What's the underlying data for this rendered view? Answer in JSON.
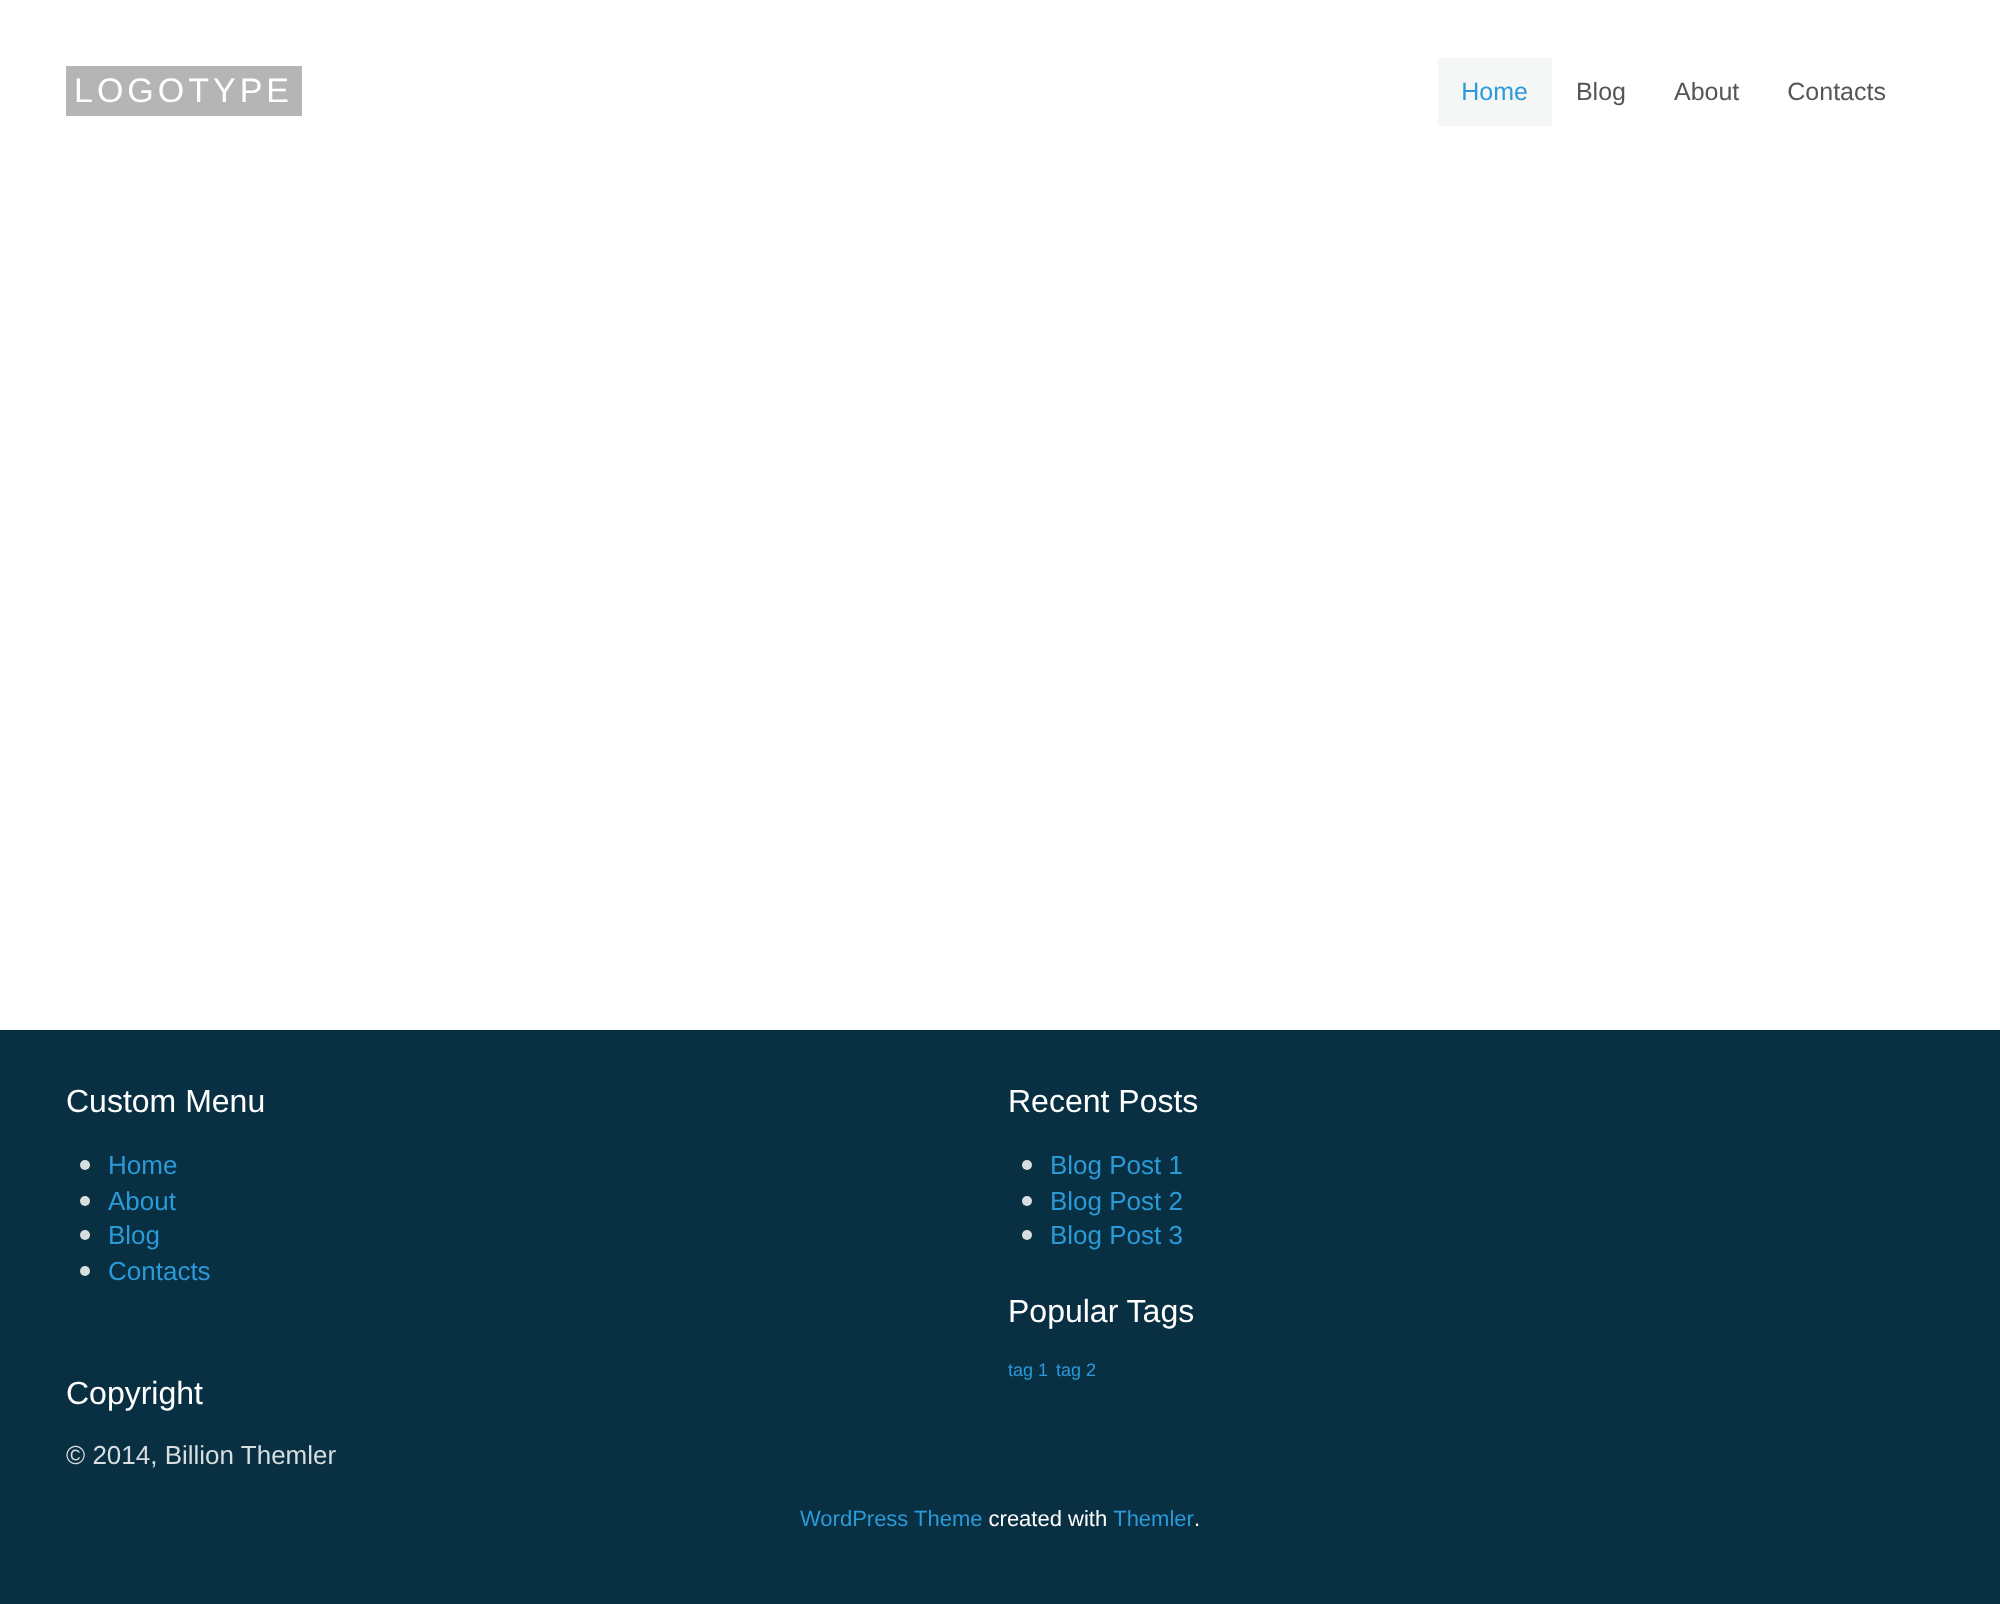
{
  "header": {
    "logo": "LOGOTYPE",
    "nav": [
      {
        "label": "Home",
        "selected": true
      },
      {
        "label": "Blog",
        "selected": false
      },
      {
        "label": "About",
        "selected": false
      },
      {
        "label": "Contacts",
        "selected": false
      }
    ]
  },
  "footer": {
    "custom_menu": {
      "title": "Custom Menu",
      "items": [
        "Home",
        "About",
        "Blog",
        "Contacts"
      ]
    },
    "recent_posts": {
      "title": "Recent Posts",
      "items": [
        "Blog Post 1",
        "Blog Post 2",
        "Blog Post 3"
      ]
    },
    "popular_tags": {
      "title": "Popular Tags",
      "tags": [
        "tag 1",
        "tag 2"
      ]
    },
    "copyright": {
      "title": "Copyright",
      "text": "© 2014, Billion Themler"
    },
    "credits": {
      "link_1": "WordPress Theme",
      "text": "created with",
      "link_2": "Themler",
      "end": "."
    }
  }
}
